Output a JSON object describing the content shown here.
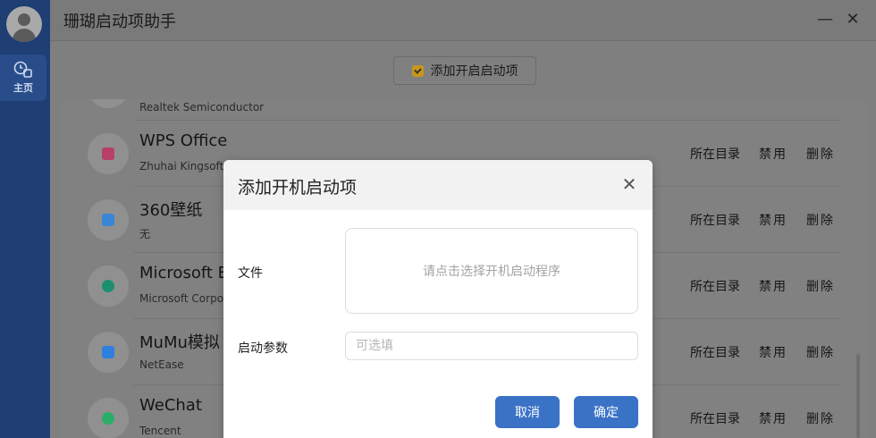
{
  "app": {
    "title": "珊瑚启动项助手"
  },
  "sidebar": {
    "home_label": "主页"
  },
  "window": {
    "minimize": "—",
    "close": "✕"
  },
  "toolbar": {
    "add_label": "添加开启启动项"
  },
  "list": {
    "partial_top_pub": "Realtek Semiconductor",
    "actions": {
      "open_dir": "所在目录",
      "disable": "禁用",
      "delete": "删除"
    },
    "items": [
      {
        "name": "WPS Office",
        "publisher": "Zhuhai Kingsoft",
        "icon_color": "#b6406a"
      },
      {
        "name": "360壁纸",
        "publisher": "无",
        "icon_color": "#3a86d6"
      },
      {
        "name": "Microsoft E",
        "publisher": "Microsoft Corpo",
        "icon_color": "#1b8f6f"
      },
      {
        "name": "MuMu模拟",
        "publisher": "NetEase",
        "icon_color": "#2f7fe0"
      },
      {
        "name": "WeChat",
        "publisher": "Tencent",
        "icon_color": "#2aae67"
      }
    ]
  },
  "dialog": {
    "title": "添加开机启动项",
    "close": "✕",
    "file_label": "文件",
    "file_placeholder": "请点击选择开机启动程序",
    "param_label": "启动参数",
    "param_placeholder": "可选填",
    "param_value": "",
    "cancel_label": "取消",
    "confirm_label": "确定"
  }
}
